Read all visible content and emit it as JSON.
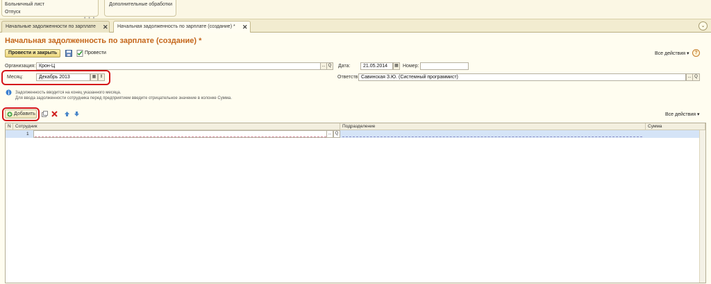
{
  "top_panel": {
    "links_left": [
      "Больничный лист",
      "Отпуск"
    ],
    "links_right": [
      "Дополнительные обработки"
    ],
    "dots": "• • •"
  },
  "tabs": [
    {
      "label": "Начальные задолженности по зарплате",
      "close": "✕"
    },
    {
      "label": "Начальная задолженность по зарплате (создание) *",
      "close": "✕"
    }
  ],
  "tabs_menu_icon": "⌄",
  "form": {
    "title": "Начальная задолженность по зарплате (создание) *",
    "post_close_label": "Провести и закрыть",
    "post_label": "Провести",
    "all_actions": "Все действия ▾",
    "help": "?",
    "org_label": "Организация:",
    "org_value": "Крон-Ц",
    "date_label": "Дата:",
    "date_value": "21.05.2014",
    "number_label": "Номер:",
    "number_value": "",
    "month_label": "Месяц:",
    "month_value": "Декабрь 2013",
    "resp_label": "Ответств.:",
    "resp_value": "Савинская З.Ю. (Системный программист)",
    "info_line1": "Задолженность вводится на конец указанного месяца.",
    "info_line2": "Для ввода задолженности сотрудника перед предприятием введите отрицательное значение в колонке Сумма.",
    "add_label": "Добавить",
    "table_all_actions": "Все действия ▾",
    "select_btn": "...",
    "search_btn": "Q",
    "calendar_btn": "▦",
    "spin_btn": "⇕"
  },
  "table": {
    "columns": [
      "N",
      "Сотрудник",
      "Подразделение",
      "Сумма"
    ],
    "rows": [
      {
        "n": "1",
        "employee": "",
        "department": "",
        "sum": ""
      }
    ]
  },
  "colors": {
    "title": "#c4651a",
    "highlight": "#d4141a",
    "selected_row": "#d5e4f7"
  }
}
